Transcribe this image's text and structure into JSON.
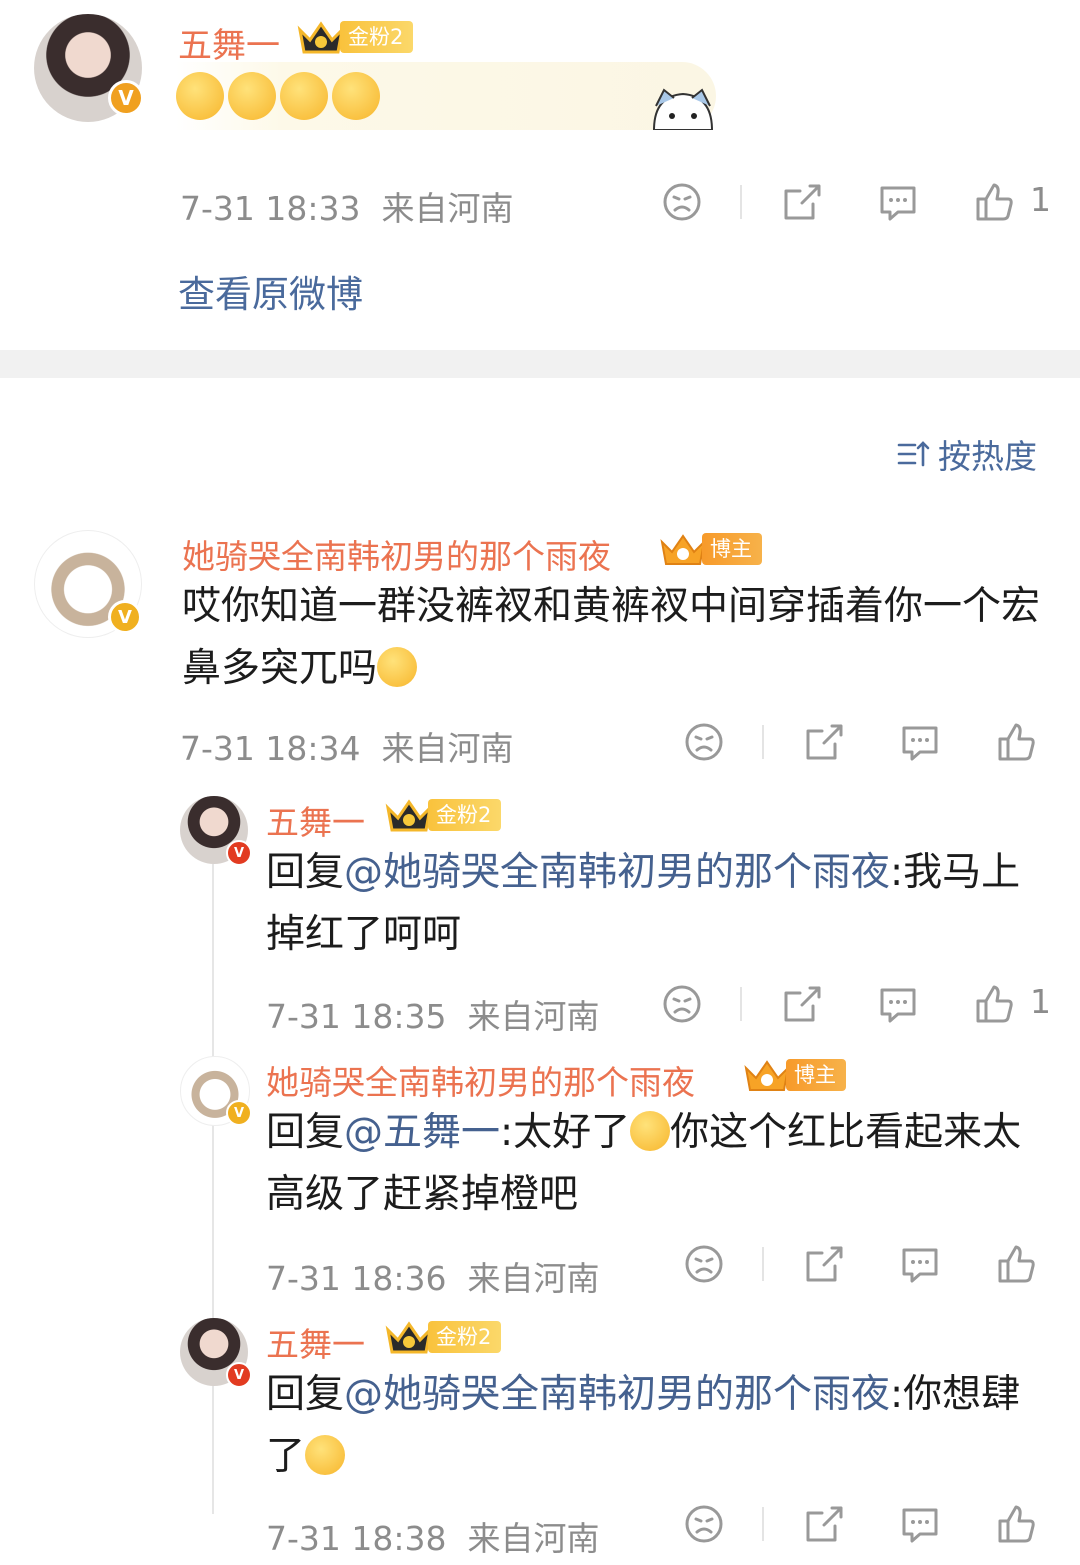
{
  "top_post": {
    "author": "五舞一",
    "fan_badge": "金粉2",
    "emojis": [
      "angry-face-emoji",
      "angry-face-emoji",
      "angry-face-emoji",
      "angry-face-emoji"
    ],
    "time": "7-31 18:33",
    "location": "来自河南",
    "like_count": "1",
    "view_original": "查看原微博"
  },
  "sort": {
    "label": "按热度"
  },
  "comments": [
    {
      "author": "她骑哭全南韩初男的那个雨夜",
      "badge": "博主",
      "text_1": "哎你知道一群没裤衩和黄裤衩中间穿插着你一个宏鼻多突兀吗",
      "time": "7-31 18:34",
      "location": "来自河南",
      "like_count": ""
    }
  ],
  "replies": [
    {
      "author": "五舞一",
      "badge": "金粉2",
      "prefix": "回复",
      "mention": "@她骑哭全南韩初男的那个雨夜",
      "text": ":我马上掉红了呵呵",
      "time": "7-31 18:35",
      "location": "来自河南",
      "like_count": "1"
    },
    {
      "author": "她骑哭全南韩初男的那个雨夜",
      "badge": "博主",
      "prefix": "回复",
      "mention": "@五舞一",
      "text_a": ":太好了",
      "text_b": "你这个红比看起来太高级了赶紧掉橙吧",
      "time": "7-31 18:36",
      "location": "来自河南",
      "like_count": ""
    },
    {
      "author": "五舞一",
      "badge": "金粉2",
      "prefix": "回复",
      "mention": "@她骑哭全南韩初男的那个雨夜",
      "text": ":你想肆了",
      "time": "7-31 18:38",
      "location": "来自河南",
      "like_count": ""
    }
  ],
  "colors": {
    "name": "#eb7350",
    "mention": "#45618f",
    "link": "#4a6a9c",
    "meta": "#8c8c8c",
    "divider": "#f1f1f1"
  }
}
